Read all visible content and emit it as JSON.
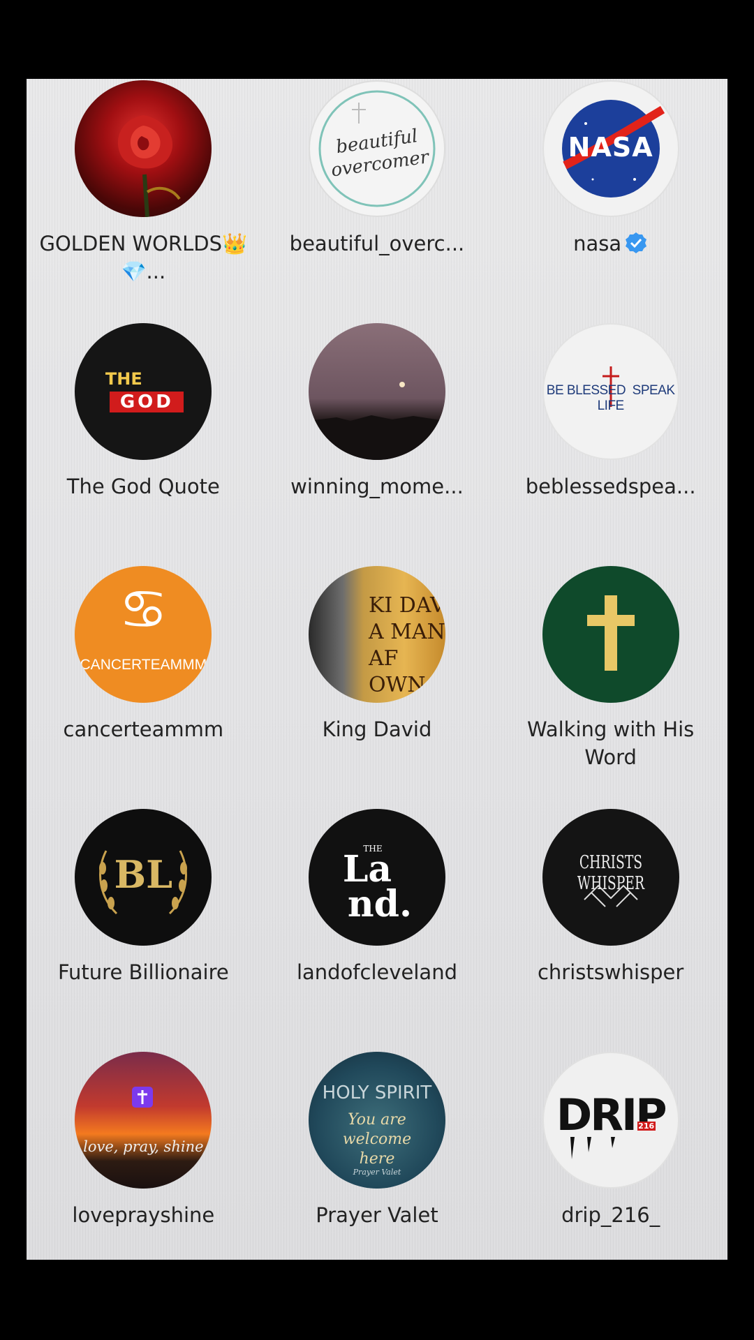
{
  "grid": {
    "items": [
      {
        "name": "GOLDEN WORLDS👑💎...",
        "avatar": "rose-avatar"
      },
      {
        "name": "beautiful_overc...",
        "avatar": "beautiful-overcomer-avatar",
        "logo_text": "beautiful overcomer"
      },
      {
        "name": "nasa",
        "avatar": "nasa-avatar",
        "logo_text": "NASA",
        "verified": true
      },
      {
        "name": "The God Quote",
        "avatar": "the-god-quote-avatar",
        "logo_text_1": "THE",
        "logo_text_2": "GOD"
      },
      {
        "name": "winning_mome...",
        "avatar": "sunset-avatar"
      },
      {
        "name": "beblessedspea...",
        "avatar": "be-blessed-avatar",
        "logo_text_1": "BE BLESSED",
        "logo_text_2": "SPEAK LIFE"
      },
      {
        "name": "cancerteammm",
        "avatar": "cancer-avatar",
        "logo_text_1": "♋",
        "logo_text_2": "CANCERTEAMMM"
      },
      {
        "name": "King David",
        "avatar": "king-david-avatar",
        "logo_text": "KI DAV A MAN AF OWN"
      },
      {
        "name": "Walking with His Word",
        "avatar": "cross-avatar"
      },
      {
        "name": "Future Billionaire",
        "avatar": "bl-avatar",
        "logo_text": "BL"
      },
      {
        "name": "landofcleveland",
        "avatar": "land-avatar",
        "logo_text_1": "THE",
        "logo_text_2": "La",
        "logo_text_3": "nd."
      },
      {
        "name": "christswhisper",
        "avatar": "christs-whisper-avatar",
        "logo_text": "CHRISTS WHISPER"
      },
      {
        "name": "loveprayshine",
        "avatar": "love-pray-shine-avatar",
        "logo_text": "love, pray, shine"
      },
      {
        "name": "Prayer Valet",
        "avatar": "holy-spirit-avatar",
        "logo_text_1": "HOLY SPIRIT",
        "logo_text_2": "You are welcome here",
        "logo_text_3": "Prayer Valet"
      },
      {
        "name": "drip_216_",
        "avatar": "drip-avatar",
        "logo_text": "DRIP",
        "logo_sub": "216"
      }
    ]
  },
  "colors": {
    "verified": "#3897f0",
    "text": "#222222",
    "background": "#e6e6e8"
  }
}
